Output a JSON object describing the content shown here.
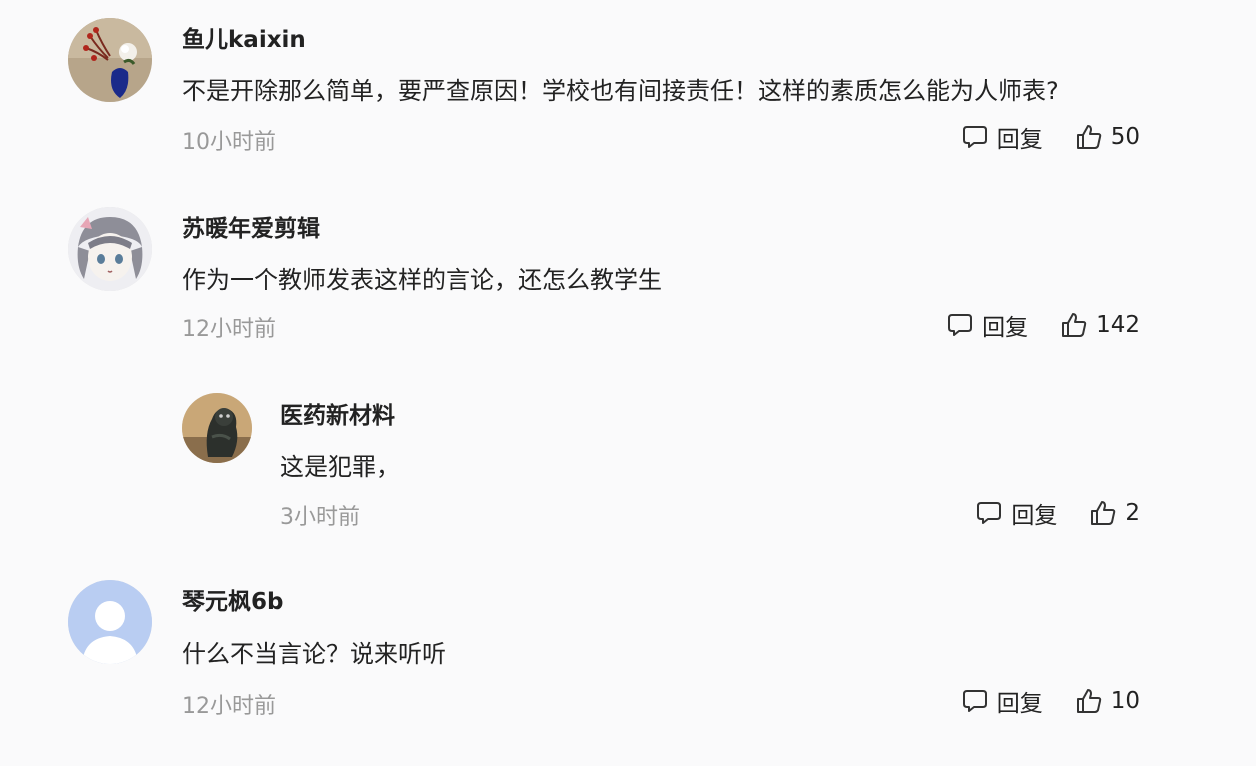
{
  "comments": [
    {
      "username": "鱼儿kaixin",
      "text": "不是开除那么简单，要严查原因！学校也有间接责任！这样的素质怎么能为人师表?",
      "time": "10小时前",
      "reply_label": "回复",
      "likes": "50",
      "reply_icon": "comment-bubble-icon",
      "like_icon": "thumbs-up-icon"
    },
    {
      "username": "苏暖年爱剪辑",
      "text": "作为一个教师发表这样的言论，还怎么教学生",
      "time": "12小时前",
      "reply_label": "回复",
      "likes": "142",
      "reply_icon": "comment-bubble-icon",
      "like_icon": "thumbs-up-icon"
    },
    {
      "username": "医药新材料",
      "text": "这是犯罪，",
      "time": "3小时前",
      "reply_label": "回复",
      "likes": "2",
      "reply_icon": "comment-bubble-icon",
      "like_icon": "thumbs-up-icon"
    },
    {
      "username": "琴元枫6b",
      "text": "什么不当言论？说来听听",
      "time": "12小时前",
      "reply_label": "回复",
      "likes": "10",
      "reply_icon": "comment-bubble-icon",
      "like_icon": "thumbs-up-icon"
    }
  ],
  "colors": {
    "background": "#fafafb",
    "username": "#222222",
    "body_text": "#222222",
    "timestamp": "#999999",
    "default_avatar": "#b9cdf2"
  }
}
